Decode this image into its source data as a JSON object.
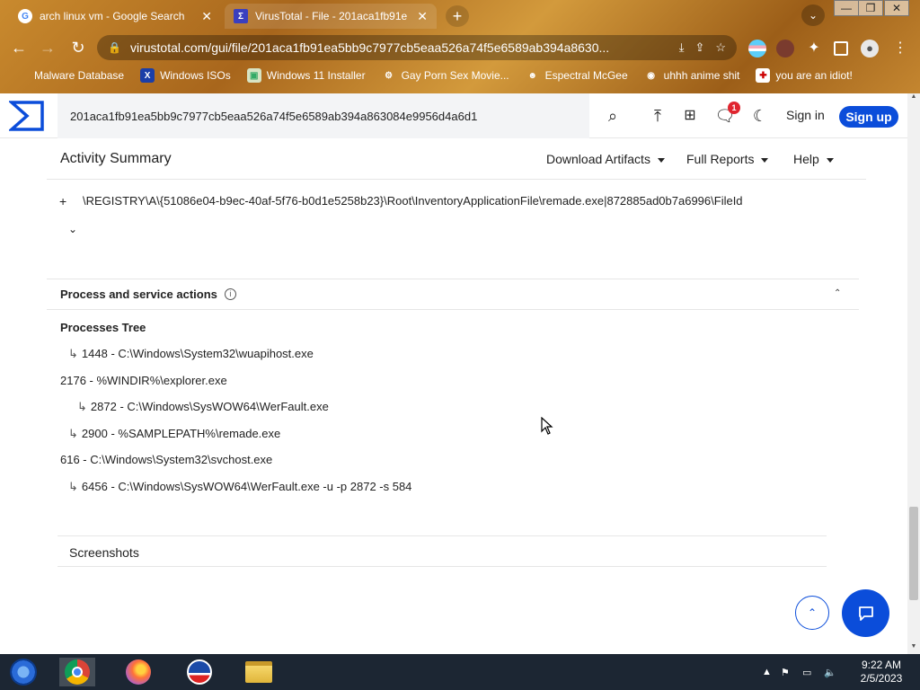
{
  "browser": {
    "tabs": [
      {
        "title": "arch linux vm - Google Search",
        "favicon": "google-icon"
      },
      {
        "title": "VirusTotal - File - 201aca1fb91e",
        "favicon": "virustotal-icon"
      }
    ],
    "url": "virustotal.com/gui/file/201aca1fb91ea5bb9c7977cb5eaa526a74f5e6589ab394a8630...",
    "bookmarks": [
      {
        "label": "Malware Database",
        "icon": "bookmark-icon"
      },
      {
        "label": "Windows ISOs",
        "icon": "x-icon"
      },
      {
        "label": "Windows 11 Installer",
        "icon": "image-icon"
      },
      {
        "label": "Gay Porn Sex Movie...",
        "icon": "gear-icon"
      },
      {
        "label": "Espectral McGee",
        "icon": "ghost-icon"
      },
      {
        "label": "uhhh anime shit",
        "icon": "anime-icon"
      },
      {
        "label": "you are an idiot!",
        "icon": "flag-icon"
      }
    ]
  },
  "vt": {
    "search_value": "201aca1fb91ea5bb9c7977cb5eaa526a74f5e6589ab394a863084e9956d4a6d1",
    "notification_count": "1",
    "sign_in": "Sign in",
    "sign_up": "Sign up",
    "activity_summary": "Activity Summary",
    "menus": {
      "download": "Download Artifacts",
      "full_reports": "Full Reports",
      "help": "Help"
    },
    "registry_plus": "+",
    "registry_key": "\\REGISTRY\\A\\{51086e04-b9ec-40af-5f76-b0d1e5258b23}\\Root\\InventoryApplicationFile\\remade.exe|872885ad0b7a6996\\FileId",
    "section_title": "Process and service actions",
    "info_glyph": "i",
    "processes_tree_title": "Processes Tree",
    "processes": [
      {
        "text": "1448 - C:\\Windows\\System32\\wuapihost.exe",
        "child": true
      },
      {
        "text": "2176 - %WINDIR%\\explorer.exe",
        "child": false
      },
      {
        "text": "2872 - C:\\Windows\\SysWOW64\\WerFault.exe",
        "child": true
      },
      {
        "text": "2900 - %SAMPLEPATH%\\remade.exe",
        "child": true
      },
      {
        "text": "616 - C:\\Windows\\System32\\svchost.exe",
        "child": false
      },
      {
        "text": "6456 - C:\\Windows\\SysWOW64\\WerFault.exe -u -p 2872 -s 584",
        "child": true
      }
    ],
    "screenshots": "Screenshots"
  },
  "taskbar": {
    "apps": [
      "start-icon",
      "chrome-icon",
      "firefox-icon",
      "obama-icon",
      "file-explorer-icon"
    ],
    "time": "9:22 AM",
    "date": "2/5/2023"
  },
  "colors": {
    "vt_blue": "#0b4dda",
    "chrome_frame": "#b87a28",
    "taskbar": "#1c2633"
  }
}
